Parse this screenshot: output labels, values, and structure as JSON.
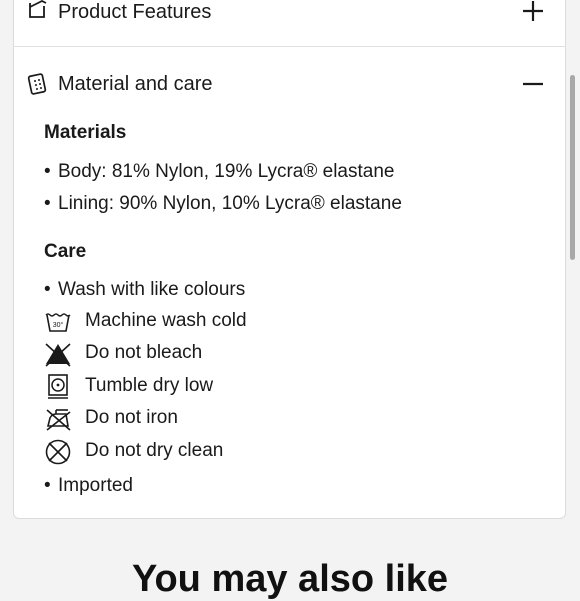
{
  "accordion": {
    "product_features": {
      "label": "Product Features",
      "icon": "hanger-tag-icon",
      "toggle_icon": "plus-icon"
    },
    "material_and_care": {
      "label": "Material and care",
      "icon": "fabric-swatch-icon",
      "toggle_icon": "minus-icon"
    }
  },
  "materials": {
    "heading": "Materials",
    "items": [
      "Body: 81% Nylon, 19% Lycra® elastane",
      "Lining: 90% Nylon, 10% Lycra® elastane"
    ]
  },
  "care": {
    "heading": "Care",
    "bullet_top": "Wash with like colours",
    "icon_items": [
      {
        "label": "Machine wash cold",
        "icon": "machine-wash-cold-icon"
      },
      {
        "label": "Do not bleach",
        "icon": "do-not-bleach-icon"
      },
      {
        "label": "Tumble dry low",
        "icon": "tumble-dry-low-icon"
      },
      {
        "label": "Do not iron",
        "icon": "do-not-iron-icon"
      },
      {
        "label": "Do not dry clean",
        "icon": "do-not-dry-clean-icon"
      }
    ],
    "bullet_bottom": "Imported"
  },
  "recommendations": {
    "heading": "You may also like"
  }
}
